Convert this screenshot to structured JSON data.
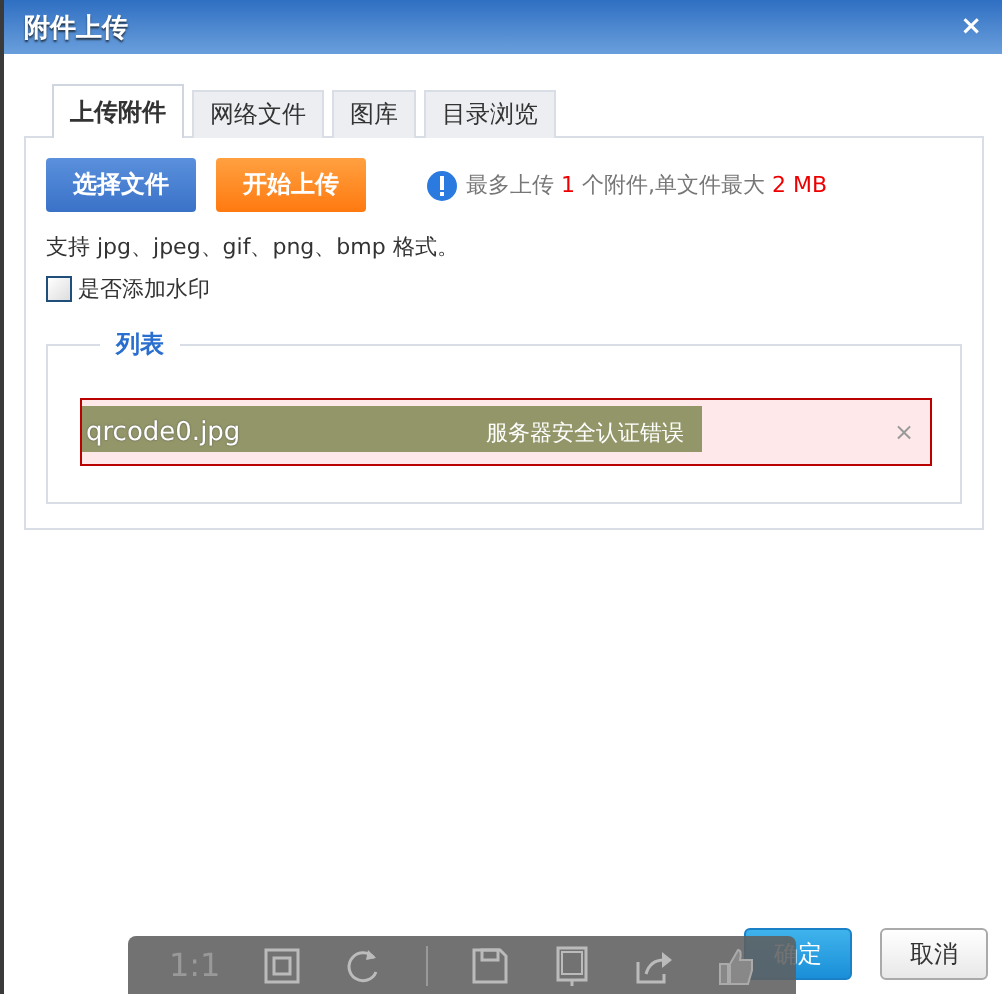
{
  "dialog": {
    "title": "附件上传",
    "close": "×"
  },
  "tabs": [
    {
      "label": "上传附件",
      "selected": true
    },
    {
      "label": "网络文件",
      "selected": false
    },
    {
      "label": "图库",
      "selected": false
    },
    {
      "label": "目录浏览",
      "selected": false
    }
  ],
  "upload": {
    "buttons": [
      {
        "label": "选择文件",
        "kind": "primary"
      },
      {
        "label": "开始上传",
        "kind": "warning"
      }
    ],
    "limit_note": [
      {
        "text": "最多上传 ",
        "highlight": false
      },
      {
        "text": "1",
        "highlight": true
      },
      {
        "text": " 个附件,单文件最大 ",
        "highlight": false
      },
      {
        "text": "2 MB",
        "highlight": true
      }
    ],
    "formats": "支持 jpg、jpeg、gif、png、bmp 格式。",
    "watermark": {
      "label": "是否添加水印",
      "checked": false
    },
    "list": {
      "legend": "列表",
      "files": [
        {
          "name": "qrcode0.jpg",
          "status": "服务器安全认证错误",
          "error": true,
          "level": 0.73,
          "remove": "×"
        }
      ]
    }
  },
  "footer": {
    "buttons": [
      {
        "label": "确定",
        "kind": "primary"
      },
      {
        "label": "取消",
        "kind": "default"
      }
    ]
  },
  "viewer_toolbar": {
    "items": [
      {
        "kind": "text",
        "label": "1:1"
      },
      {
        "kind": "fit"
      },
      {
        "kind": "rotate"
      },
      {
        "kind": "separator"
      },
      {
        "kind": "save"
      },
      {
        "kind": "frame"
      },
      {
        "kind": "share"
      },
      {
        "kind": "like"
      }
    ]
  }
}
